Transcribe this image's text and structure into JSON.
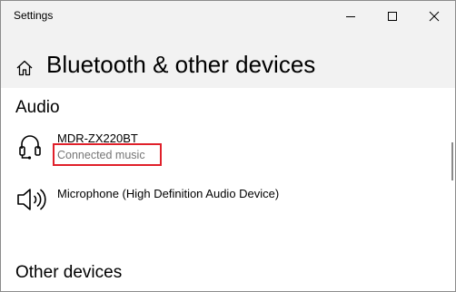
{
  "window": {
    "title": "Settings",
    "minimize_icon": "minimize-icon",
    "maximize_icon": "maximize-icon",
    "close_icon": "close-icon"
  },
  "header": {
    "home_icon": "home-icon",
    "title": "Bluetooth & other devices"
  },
  "audio": {
    "heading": "Audio",
    "devices": [
      {
        "name": "MDR-ZX220BT",
        "status": "Connected music",
        "icon": "headphones-icon",
        "highlighted": true
      },
      {
        "name": "Microphone (High Definition Audio Device)",
        "status": "",
        "icon": "speaker-icon",
        "highlighted": false
      }
    ]
  },
  "other": {
    "heading": "Other devices"
  },
  "colors": {
    "header_bg": "#f2f2f2",
    "status_text": "#767676",
    "highlight": "#e0202a"
  }
}
